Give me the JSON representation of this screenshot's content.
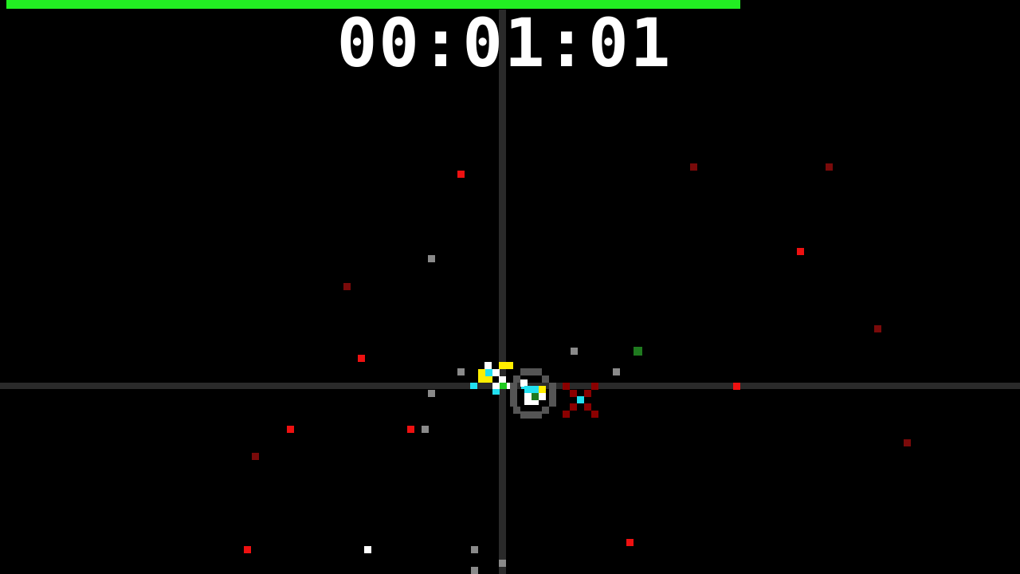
{
  "hud": {
    "timer": "00:01:01",
    "health_fraction": 1.0
  },
  "colors": {
    "background": "#000000",
    "health": "#22ee22",
    "axis": "#2a2a2a",
    "timer_text": "#ffffff",
    "red_particle": "#ee1111",
    "dark_red_particle": "#7a0a0a",
    "gray_particle": "#8a8a8a",
    "green_particle": "#1f7a1f",
    "white_particle": "#ffffff",
    "player_yellow": "#ffee00",
    "player_cyan": "#22e0f0",
    "player_white": "#ffffff",
    "player_green": "#22cc22",
    "enemy_gray": "#555555",
    "enemy_dark_red": "#8b0000"
  },
  "sprites": {
    "player": "player-ship",
    "ring_enemy": "ring-enemy",
    "cross_enemy": "x-enemy"
  }
}
